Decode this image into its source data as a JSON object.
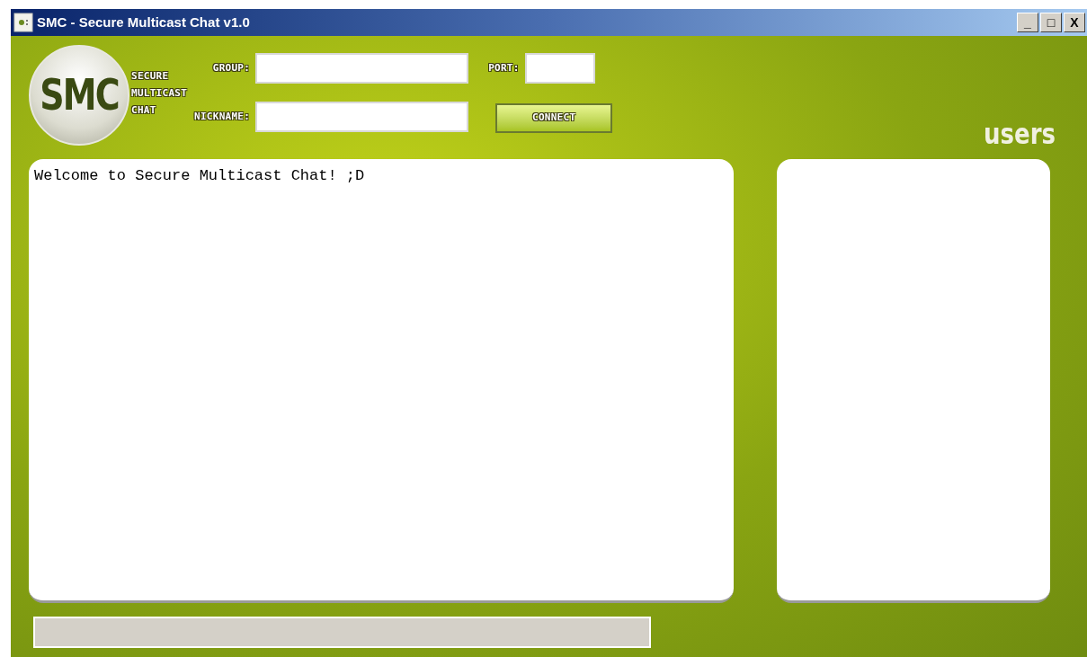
{
  "window": {
    "title": "SMC - Secure Multicast Chat v1.0",
    "controls": [
      "_",
      "□",
      "X"
    ]
  },
  "logo": {
    "mark": "SMC",
    "lines": [
      "SECURE",
      "MULTICAST",
      "CHAT"
    ]
  },
  "form": {
    "fields": [
      {
        "label": "GROUP:"
      },
      {
        "label": "PORT:"
      },
      {
        "label": "NICKNAME:"
      }
    ],
    "button": "CONNECT"
  },
  "users": {
    "heading": "users"
  },
  "chat": {
    "messages": [
      "Welcome to Secure Multicast Chat! ;D"
    ]
  }
}
